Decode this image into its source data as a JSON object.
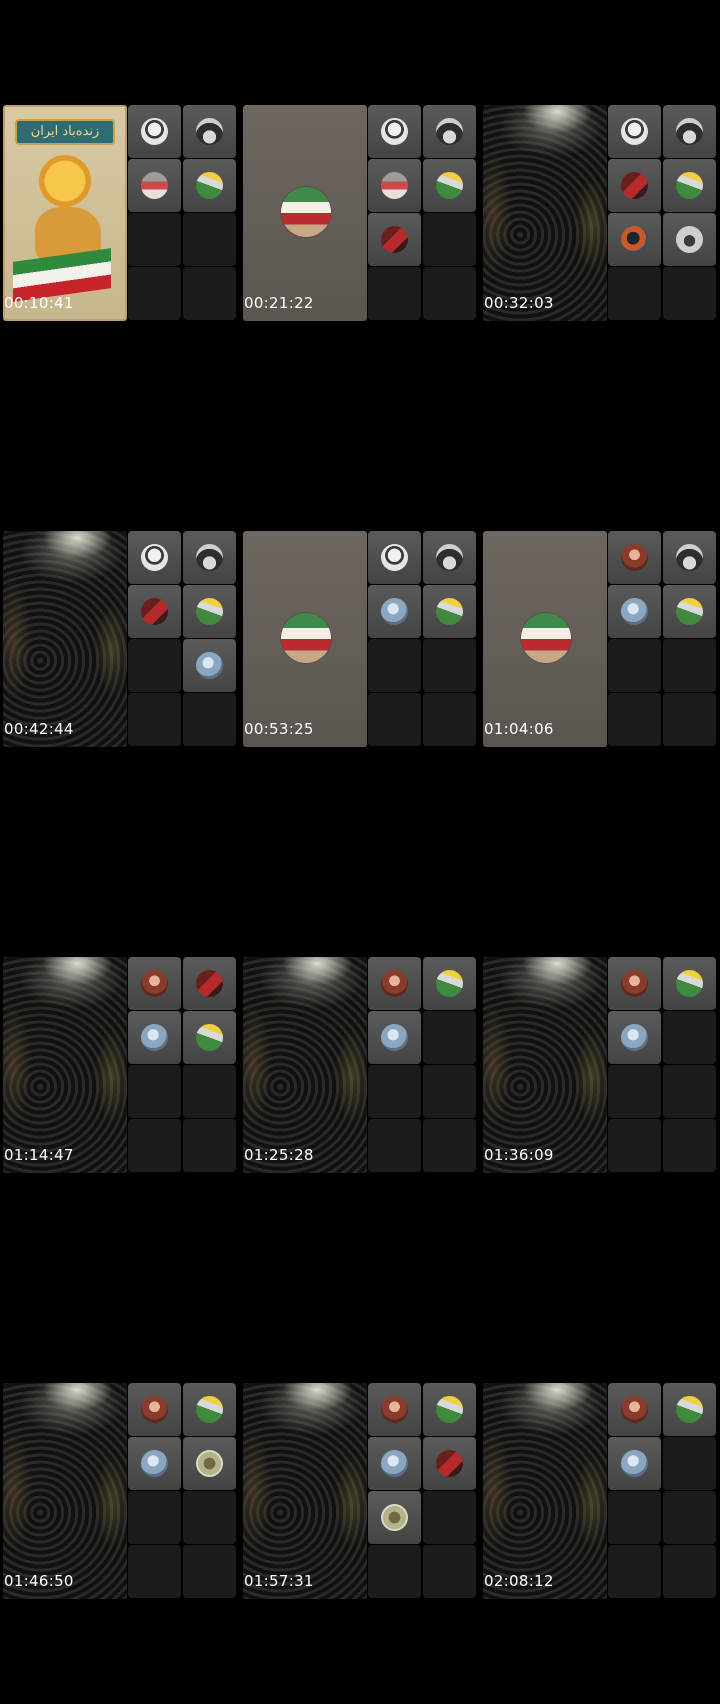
{
  "frames": [
    {
      "timestamp": "00:10:41",
      "main": "poster",
      "poster_text": "زنده‌باد ایران",
      "tiles": [
        "woman-sketch",
        "hat",
        "flag-person",
        "flag-green",
        "",
        "",
        "",
        ""
      ]
    },
    {
      "timestamp": "00:21:22",
      "main": "flag",
      "tiles": [
        "woman-sketch",
        "hat",
        "flag-person",
        "flag-green",
        "red-flag",
        "",
        "",
        ""
      ]
    },
    {
      "timestamp": "00:32:03",
      "main": "crowd",
      "tiles": [
        "woman-sketch",
        "hat",
        "red-flag",
        "flag-green",
        "orange-man",
        "horse",
        "",
        ""
      ]
    },
    {
      "timestamp": "00:42:44",
      "main": "crowd",
      "tiles": [
        "woman-sketch",
        "hat",
        "red-flag",
        "flag-green",
        "",
        "globe",
        "",
        ""
      ]
    },
    {
      "timestamp": "00:53:25",
      "main": "flag",
      "tiles": [
        "woman-sketch",
        "hat",
        "globe",
        "flag-green",
        "",
        "",
        "",
        ""
      ]
    },
    {
      "timestamp": "01:04:06",
      "main": "flag",
      "tiles": [
        "woman-red",
        "hat",
        "globe",
        "flag-green",
        "",
        "",
        "",
        ""
      ]
    },
    {
      "timestamp": "01:14:47",
      "main": "crowd",
      "tiles": [
        "woman-red",
        "red-flag",
        "globe",
        "flag-green",
        "",
        "",
        "",
        ""
      ]
    },
    {
      "timestamp": "01:25:28",
      "main": "crowd",
      "tiles": [
        "woman-red",
        "flag-green",
        "globe",
        "",
        "",
        "",
        "",
        ""
      ]
    },
    {
      "timestamp": "01:36:09",
      "main": "crowd",
      "tiles": [
        "woman-red",
        "flag-green",
        "globe",
        "",
        "",
        "",
        "",
        ""
      ]
    },
    {
      "timestamp": "01:46:50",
      "main": "crowd",
      "tiles": [
        "woman-red",
        "flag-green",
        "globe",
        "camo",
        "",
        "",
        "",
        ""
      ]
    },
    {
      "timestamp": "01:57:31",
      "main": "crowd",
      "tiles": [
        "woman-red",
        "flag-green",
        "globe",
        "red-flag",
        "camo",
        "",
        "",
        ""
      ]
    },
    {
      "timestamp": "02:08:12",
      "main": "crowd",
      "tiles": [
        "woman-red",
        "flag-green",
        "globe",
        "",
        "",
        "",
        "",
        ""
      ]
    }
  ]
}
